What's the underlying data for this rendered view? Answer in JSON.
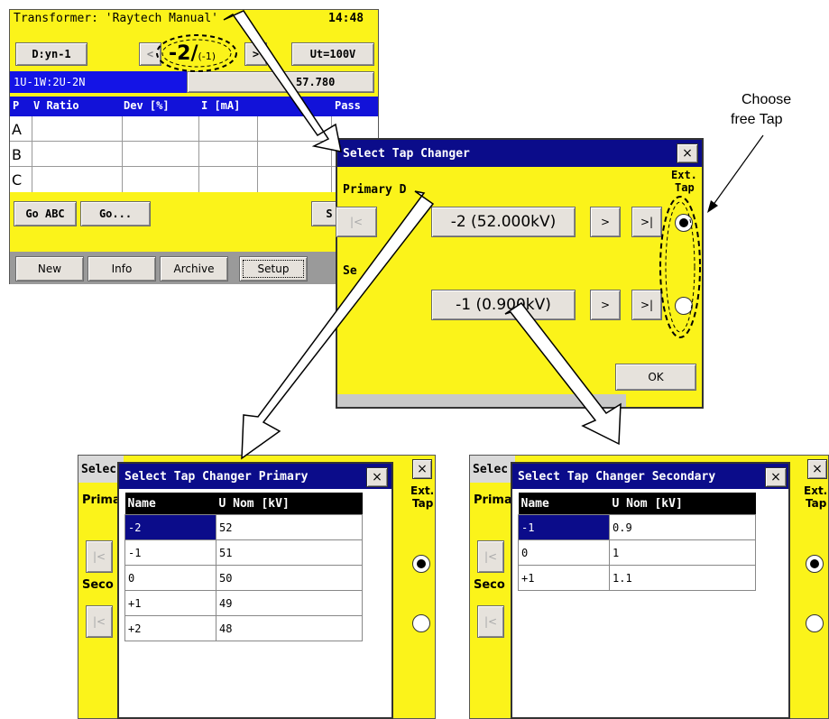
{
  "main_screen": {
    "title": "Transformer: 'Raytech Manual'",
    "time": "14:48",
    "vector_button": "D:yn-1",
    "prev_button": "<",
    "tap_big": "-2/",
    "tap_small": "(-1)",
    "next_button": ">",
    "voltage_button": "Ut=100V",
    "phase_label": "1U-1W:2U-2N",
    "ratio_value": "57.780",
    "columns": [
      "P",
      "V Ratio",
      "Dev [%]",
      "I [mA]",
      "",
      "Pass"
    ],
    "rows": [
      "A",
      "B",
      "C"
    ],
    "go_abc": "Go ABC",
    "go": "Go...",
    "right_partial_button": "S",
    "tabs": [
      "New",
      "Info",
      "Archive",
      "Setup"
    ]
  },
  "tap_dialog": {
    "title": "Select Tap Changer",
    "close": "×",
    "primary_label": "Primary D",
    "secondary_label": "Se",
    "ext_tap_label_1": "Ext.",
    "ext_tap_label_2": "Tap",
    "first_button": "|<",
    "primary_value": "-2 (52.000kV)",
    "secondary_value": "-1 (0.900kV)",
    "next_button": ">",
    "last_button": ">|",
    "ok_button": "OK",
    "primary_ext_selected": true,
    "secondary_ext_selected": false
  },
  "callout": {
    "line1": "Choose",
    "line2": "free Tap"
  },
  "primary_list": {
    "background_title": "Selec",
    "title": "Select Tap Changer Primary",
    "close": "×",
    "bg_labels": [
      "Prima",
      "Seco"
    ],
    "bg_ext": [
      "Ext.",
      "Tap"
    ],
    "bg_first_button": "|<",
    "bg_close": "×",
    "columns": [
      "Name",
      "U Nom [kV]"
    ],
    "rows": [
      {
        "name": "-2",
        "unom": "52"
      },
      {
        "name": "-1",
        "unom": "51"
      },
      {
        "name": "0",
        "unom": "50"
      },
      {
        "name": "+1",
        "unom": "49"
      },
      {
        "name": "+2",
        "unom": "48"
      }
    ],
    "selected_index": 0
  },
  "secondary_list": {
    "background_title": "Selec",
    "title": "Select Tap Changer Secondary",
    "close": "×",
    "bg_labels": [
      "Prima",
      "Seco"
    ],
    "bg_ext": [
      "Ext.",
      "Tap"
    ],
    "bg_first_button": "|<",
    "bg_close": "×",
    "columns": [
      "Name",
      "U Nom [kV]"
    ],
    "rows": [
      {
        "name": "-1",
        "unom": "0.9"
      },
      {
        "name": "0",
        "unom": "1"
      },
      {
        "name": "+1",
        "unom": "1.1"
      }
    ],
    "selected_index": 0
  }
}
